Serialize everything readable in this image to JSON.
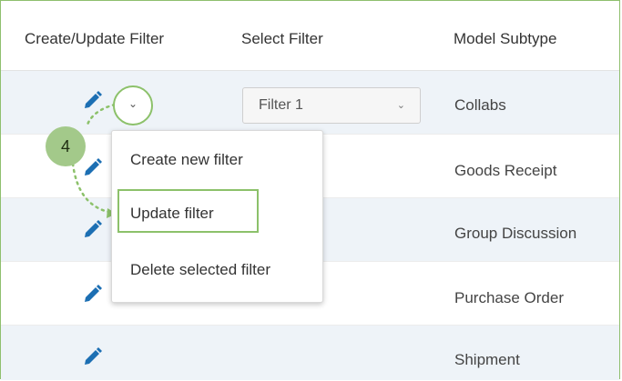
{
  "header": {
    "col1": "Create/Update Filter",
    "col2": "Select Filter",
    "col3": "Model Subtype"
  },
  "rows": [
    {
      "subtype": "Collabs"
    },
    {
      "subtype": "Goods Receipt"
    },
    {
      "subtype": "Group Discussion"
    },
    {
      "subtype": "Purchase Order"
    },
    {
      "subtype": "Shipment"
    }
  ],
  "select": {
    "value": "Filter 1"
  },
  "step": "4",
  "menu": {
    "items": [
      "Create new filter",
      "Update filter",
      "Delete selected filter"
    ]
  },
  "colors": {
    "accent": "#8cc16a",
    "pencil": "#1c6fb3",
    "row_shade": "#eef3f8"
  }
}
